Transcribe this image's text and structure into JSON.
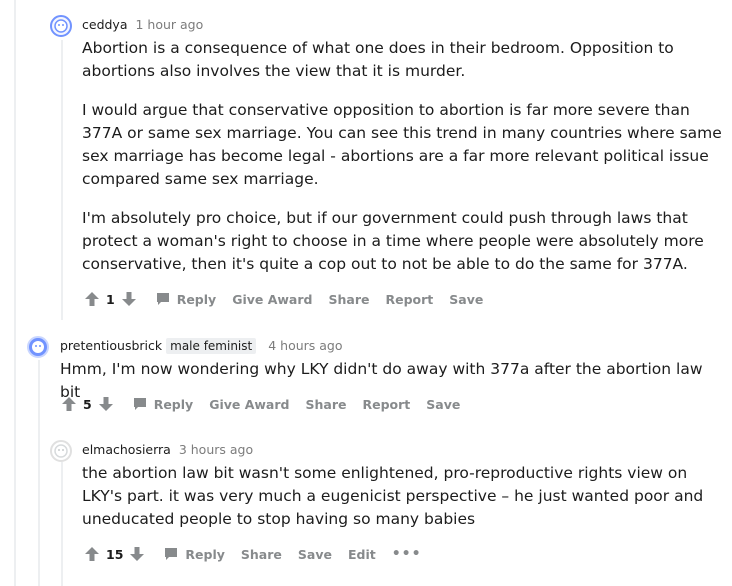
{
  "comments": [
    {
      "author": "ceddya",
      "flair": "",
      "time": "1 hour ago",
      "paragraphs": [
        "Abortion is a consequence of what one does in their bedroom. Opposition to abortions also involves the view that it is murder.",
        "I would argue that conservative opposition to abortion is far more severe than 377A or same sex marriage. You can see this trend in many countries where same sex marriage has become legal - abortions are a far more relevant political issue compared same sex marriage.",
        "I'm absolutely pro choice, but if our government could push through laws that protect a woman's right to choose in a time where people were absolutely more conservative, then it's quite a cop out to not be able to do the same for 377A."
      ],
      "score": "1",
      "actions": {
        "reply": "Reply",
        "award": "Give Award",
        "share": "Share",
        "report": "Report",
        "save": "Save"
      }
    },
    {
      "author": "pretentiousbrick",
      "flair": "male feminist",
      "time": "4 hours ago",
      "paragraphs": [
        "Hmm, I'm now wondering why LKY didn't do away with 377a after the abortion law bit"
      ],
      "score": "5",
      "actions": {
        "reply": "Reply",
        "award": "Give Award",
        "share": "Share",
        "report": "Report",
        "save": "Save"
      }
    },
    {
      "author": "elmachosierra",
      "flair": "",
      "time": "3 hours ago",
      "paragraphs": [
        "the abortion law bit wasn't some enlightened, pro-reproductive rights view on LKY's part. it was very much a eugenicist perspective – he just wanted poor and uneducated people to stop having so many babies"
      ],
      "score": "15",
      "actions": {
        "reply": "Reply",
        "share": "Share",
        "save": "Save",
        "edit": "Edit",
        "more": "•••"
      }
    }
  ],
  "colors": {
    "meta_gray": "#7c7c7c",
    "action_gray": "#878a8c",
    "thread_line": "#edeff1",
    "avatar_blue": "#7193ff"
  },
  "icons": [
    "upvote-arrow-icon",
    "downvote-arrow-icon",
    "comment-bubble-icon",
    "user-avatar-icon",
    "more-options-icon"
  ]
}
